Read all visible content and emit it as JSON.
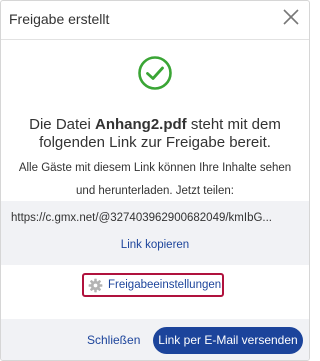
{
  "dialog": {
    "title": "Freigabe erstellt",
    "close_icon": "close-icon",
    "success_icon": "check-circle-icon",
    "headline_prefix": "Die Datei ",
    "file_name": "Anhang2.pdf",
    "headline_suffix": " steht mit dem folgenden Link zur Freigabe bereit.",
    "description": "Alle Gäste mit diesem Link können Ihre Inhalte sehen und herunterladen. Jetzt teilen:",
    "share_url": "https://c.gmx.net/@327403962900682049/kmIbG...",
    "copy_link_label": "Link kopieren",
    "settings_icon": "gear-icon",
    "settings_label": "Freigabeeinstellungen",
    "close_button_label": "Schließen",
    "email_button_label": "Link per E-Mail versenden"
  },
  "colors": {
    "accent": "#1c449b",
    "success": "#3aa535",
    "highlight_border": "#b0123d",
    "panel_background": "#f1f2f5"
  }
}
